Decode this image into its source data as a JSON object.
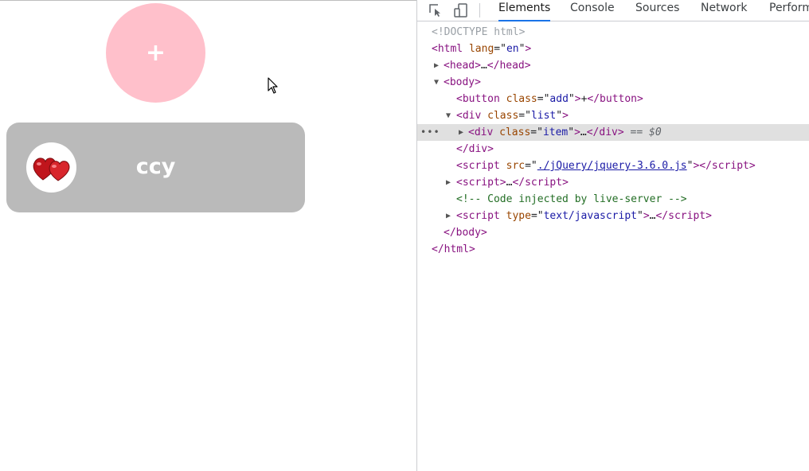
{
  "page": {
    "add_button_label": "+",
    "item": {
      "name": "ccy",
      "avatar_icon": "hearts-icon"
    }
  },
  "devtools": {
    "tabs": [
      "Elements",
      "Console",
      "Sources",
      "Network",
      "Perform"
    ],
    "active_tab": "Elements",
    "tree": {
      "doctype": "<!DOCTYPE html>",
      "html_open_tag": "html",
      "html_attr_name": "lang",
      "html_attr_value": "en",
      "head_tag": "head",
      "body_tag": "body",
      "button_tag": "button",
      "button_class": "add",
      "button_text": "+",
      "list_tag": "div",
      "list_class": "list",
      "item_tag": "div",
      "item_class": "item",
      "selected_marker": "== $0",
      "script_src_value": "./jQuery/jquery-3.6.0.js",
      "comment": "<!-- Code injected by live-server -->",
      "script_type_value": "text/javascript",
      "ellipsis": "…"
    }
  },
  "colors": {
    "add_button": "#ffc0cb",
    "item_card": "#bababa",
    "active_tab_underline": "#1a73e8",
    "selected_row": "#e0e0e0"
  }
}
